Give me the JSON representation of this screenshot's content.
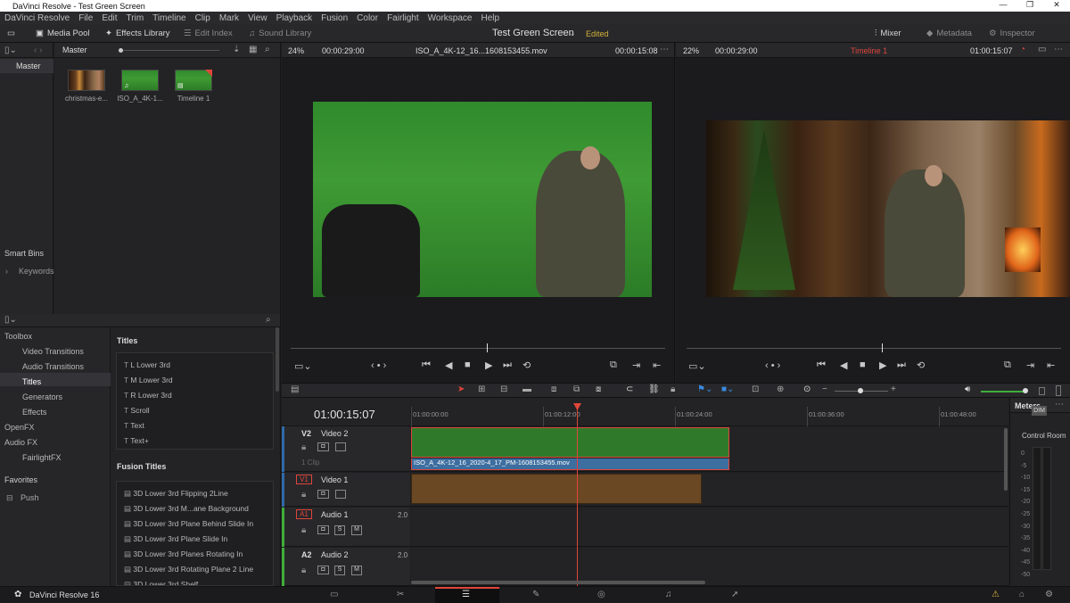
{
  "window": {
    "title": "DaVinci Resolve - Test Green Screen",
    "minimize": "—",
    "maximize": "❐",
    "close": "✕"
  },
  "menu": [
    "DaVinci Resolve",
    "File",
    "Edit",
    "Trim",
    "Timeline",
    "Clip",
    "Mark",
    "View",
    "Playback",
    "Fusion",
    "Color",
    "Fairlight",
    "Workspace",
    "Help"
  ],
  "toolbar": {
    "media_pool": "Media Pool",
    "effects_library": "Effects Library",
    "edit_index": "Edit Index",
    "sound_library": "Sound Library",
    "project_title": "Test Green Screen",
    "edited": "Edited",
    "mixer": "Mixer",
    "metadata": "Metadata",
    "inspector": "Inspector"
  },
  "media_pool": {
    "root": "Master",
    "bin_header": "Master",
    "smart_bins": "Smart Bins",
    "keywords": "Keywords",
    "clips": [
      {
        "label": "christmas-e...",
        "kind": "xmas"
      },
      {
        "label": "ISO_A_4K-1...",
        "kind": "green"
      },
      {
        "label": "Timeline 1",
        "kind": "timeline"
      }
    ]
  },
  "source_viewer": {
    "zoom": "24%",
    "duration": "00:00:29:00",
    "clip_name": "ISO_A_4K-12_16...1608153455.mov",
    "timecode": "00:00:15:08"
  },
  "timeline_viewer": {
    "zoom": "22%",
    "duration": "00:00:29:00",
    "timeline_name": "Timeline 1",
    "timecode": "01:00:15:07"
  },
  "effects": {
    "tree": [
      {
        "label": "Toolbox",
        "indent": 0
      },
      {
        "label": "Video Transitions",
        "indent": 1
      },
      {
        "label": "Audio Transitions",
        "indent": 1
      },
      {
        "label": "Titles",
        "indent": 1,
        "selected": true
      },
      {
        "label": "Generators",
        "indent": 1
      },
      {
        "label": "Effects",
        "indent": 1
      },
      {
        "label": "OpenFX",
        "indent": 0
      },
      {
        "label": "Audio FX",
        "indent": 0
      },
      {
        "label": "FairlightFX",
        "indent": 1
      }
    ],
    "favorites": "Favorites",
    "favorite_items": [
      "Push"
    ],
    "titles_header": "Titles",
    "titles": [
      "L Lower 3rd",
      "M Lower 3rd",
      "R Lower 3rd",
      "Scroll",
      "Text",
      "Text+"
    ],
    "fusion_header": "Fusion Titles",
    "fusion_titles": [
      "3D Lower 3rd Flipping 2Line",
      "3D Lower 3rd M...ane Background",
      "3D Lower 3rd Plane Behind Slide In",
      "3D Lower 3rd Plane Slide In",
      "3D Lower 3rd Planes Rotating In",
      "3D Lower 3rd Rotating Plane 2 Line",
      "3D Lower 3rd Shelf"
    ]
  },
  "timeline": {
    "timecode": "01:00:15:07",
    "ruler": [
      "01:00:00:00",
      "01:00:12:00",
      "01:00:24:00",
      "01:00:36:00",
      "01:00:48:00"
    ],
    "tracks": [
      {
        "id": "V2",
        "name": "Video 2",
        "info": "1 Clip"
      },
      {
        "id": "V1",
        "name": "Video 1",
        "info": ""
      },
      {
        "id": "A1",
        "name": "Audio 1",
        "info": "2.0"
      },
      {
        "id": "A2",
        "name": "Audio 2",
        "info": "2.0"
      }
    ],
    "clip_v2_name": "ISO_A_4K-12_16_2020-4_17_PM-1608153455.mov",
    "solo": "S",
    "mute": "M"
  },
  "meters": {
    "title": "Meters",
    "control_room": "Control Room",
    "dim": "DIM",
    "scale": [
      "0",
      "-5",
      "-10",
      "-15",
      "-20",
      "-25",
      "-30",
      "-35",
      "-40",
      "-45",
      "-50"
    ]
  },
  "footer": {
    "app_name": "DaVinci Resolve 16"
  },
  "colors": {
    "accent_red": "#e0453a",
    "edited_yellow": "#d4b33a",
    "clip_blue": "#3d6ea0",
    "green_screen": "#3f9b34"
  }
}
